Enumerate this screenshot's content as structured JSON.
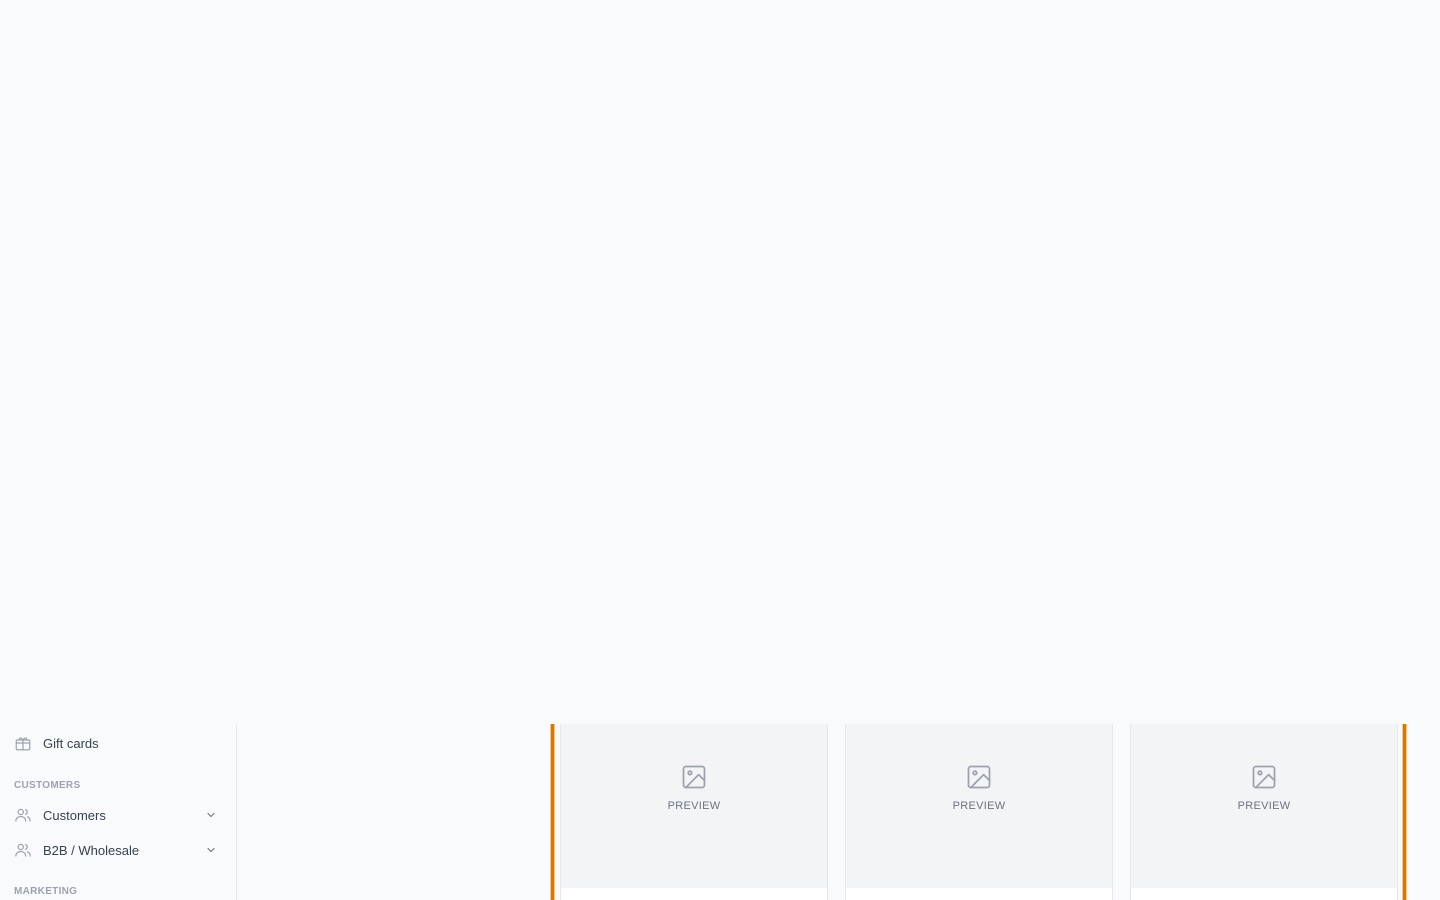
{
  "sidebar": {
    "items_top": [
      {
        "label": "Gift cards",
        "icon": "gift-icon"
      }
    ],
    "sections": [
      {
        "header": "CUSTOMERS",
        "items": [
          {
            "label": "Customers",
            "icon": "users-icon",
            "expandable": true
          },
          {
            "label": "B2B / Wholesale",
            "icon": "users-icon",
            "expandable": true
          }
        ]
      },
      {
        "header": "MARKETING",
        "items": []
      }
    ]
  },
  "main": {
    "cards": [
      {
        "preview_label": "PREVIEW",
        "icon": "image-placeholder-icon"
      },
      {
        "preview_label": "PREVIEW",
        "icon": "image-placeholder-icon"
      },
      {
        "preview_label": "PREVIEW",
        "icon": "image-placeholder-icon"
      }
    ],
    "accent_color": "#d97706"
  },
  "colors": {
    "background": "#f9fafb",
    "preview_background": "#f3f4f6",
    "muted_text": "#9ca3af",
    "body_text": "#374151"
  }
}
